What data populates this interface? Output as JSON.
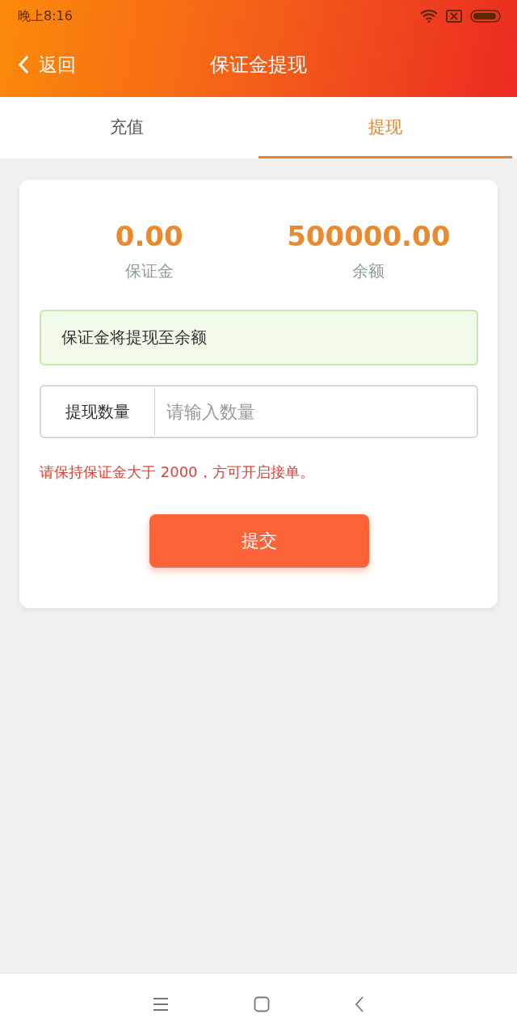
{
  "status_bar": {
    "time": "晚上8:16"
  },
  "header": {
    "back": "返回",
    "title": "保证金提现"
  },
  "tabs": [
    {
      "label": "充值",
      "selected": false
    },
    {
      "label": "提现",
      "selected": true
    }
  ],
  "stats": [
    {
      "value": "0.00",
      "label": "保证金"
    },
    {
      "value": "500000.00",
      "label": "余额"
    }
  ],
  "notice": "保证金将提现至余额",
  "amount_field": {
    "label": "提现数量",
    "placeholder": "请输入数量"
  },
  "warning": "请保持保证金大于 2000，方可开启接单。",
  "submit": "提交"
}
